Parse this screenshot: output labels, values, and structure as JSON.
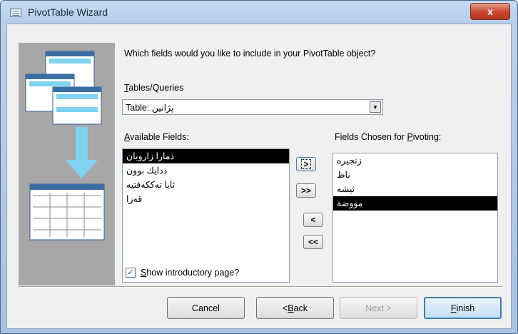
{
  "window": {
    "title": "PivotTable Wizard",
    "close_glyph": "x"
  },
  "prompt": "Which fields would you like to include in your PivotTable object?",
  "tables_queries": {
    "label_pre": "",
    "label_key": "T",
    "label_post": "ables/Queries",
    "selected": "Table: پژانین"
  },
  "available": {
    "label_pre": "",
    "label_key": "A",
    "label_post": "vailable Fields:",
    "items": [
      "ذمارا زاروبان",
      "ذدایك بوون",
      "ثایا تەککەفتیە",
      "قەزا"
    ],
    "selected_index": 0
  },
  "chosen": {
    "label_pre": "Fields Chosen for ",
    "label_key": "P",
    "label_post": "ivoting:",
    "items": [
      "زنجیره",
      "ناظ",
      "ثیشە",
      "مووضة"
    ],
    "selected_index": 3
  },
  "move_buttons": {
    "add": ">",
    "add_all": ">>",
    "remove": "<",
    "remove_all": "<<"
  },
  "show_intro": {
    "checked": true,
    "glyph": "✓",
    "label_pre": "",
    "label_key": "S",
    "label_post": "how introductory page?"
  },
  "buttons": {
    "cancel": "Cancel",
    "back_pre": "< ",
    "back_key": "B",
    "back_post": "ack",
    "next": "Next >",
    "finish_pre": "",
    "finish_key": "F",
    "finish_post": "inish"
  }
}
